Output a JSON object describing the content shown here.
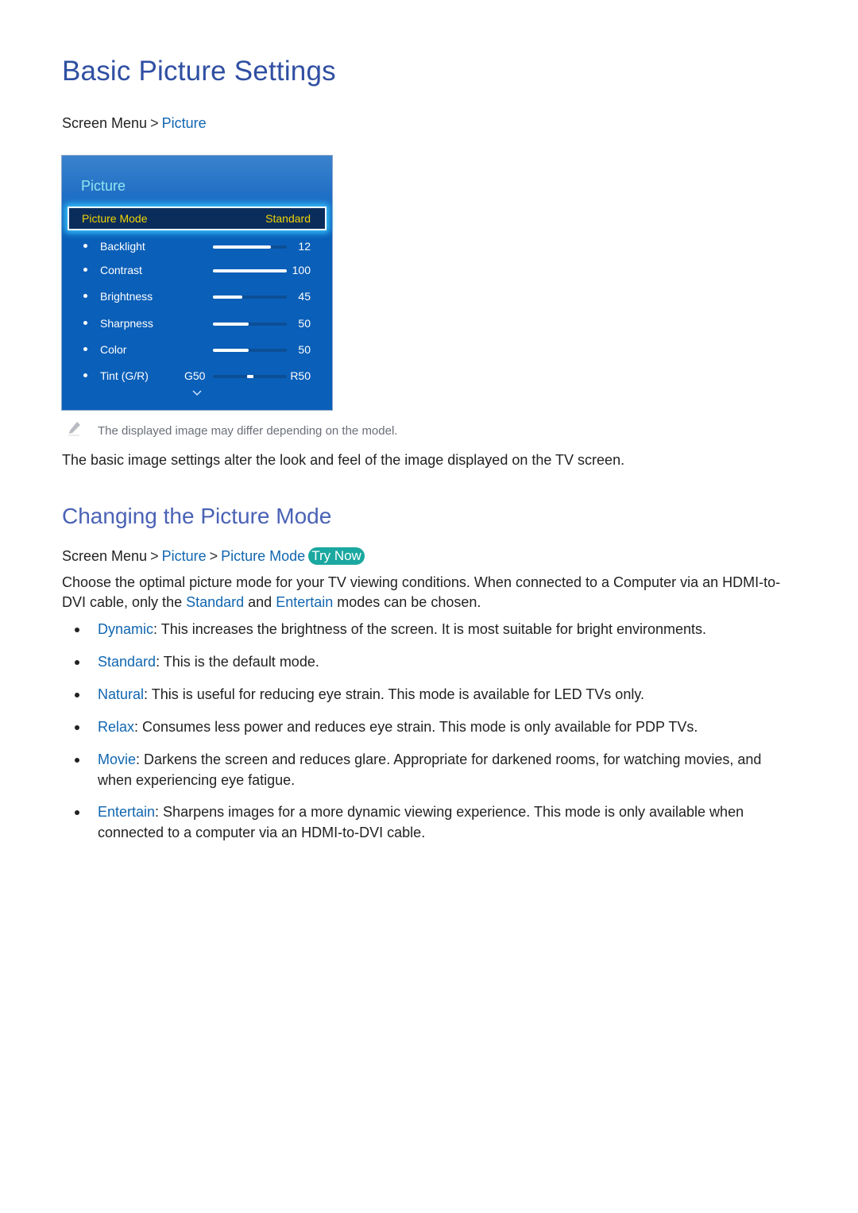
{
  "title": "Basic Picture Settings",
  "breadcrumb1": {
    "root": "Screen Menu",
    "items": [
      "Picture"
    ]
  },
  "tv_menu": {
    "title": "Picture",
    "picture_mode": {
      "label": "Picture Mode",
      "value": "Standard"
    },
    "settings": [
      {
        "label": "Backlight",
        "value": "12",
        "fill_fraction": 0.79
      },
      {
        "label": "Contrast",
        "value": "100",
        "fill_fraction": 1.0
      },
      {
        "label": "Brightness",
        "value": "45",
        "fill_fraction": 0.4
      },
      {
        "label": "Sharpness",
        "value": "50",
        "fill_fraction": 0.48
      },
      {
        "label": "Color",
        "value": "50",
        "fill_fraction": 0.48
      }
    ],
    "tint": {
      "label": "Tint (G/R)",
      "left": "G50",
      "right": "R50",
      "position_fraction": 0.5
    },
    "more_icon": "chevron-down-icon",
    "colors": {
      "selection_text": "#f0d400",
      "title_text": "#8fe6f0",
      "panel_bg": "#0a5fb8"
    }
  },
  "note": {
    "icon": "pencil-icon",
    "text": "The displayed image may differ depending on the model."
  },
  "intro": "The basic image settings alter the look and feel of the image displayed on the TV screen.",
  "section": {
    "title": "Changing the Picture Mode",
    "breadcrumb": {
      "root": "Screen Menu",
      "items": [
        "Picture",
        "Picture Mode"
      ],
      "try_now": "Try Now"
    },
    "para": {
      "part1": "Choose the optimal picture mode for your TV viewing conditions. When connected to a Computer via an HDMI-to-DVI cable, only the ",
      "kw1": "Standard",
      "part2": " and ",
      "kw2": "Entertain",
      "part3": " modes can be chosen."
    },
    "modes": [
      {
        "name": "Dynamic",
        "desc": ": This increases the brightness of the screen. It is most suitable for bright environments."
      },
      {
        "name": "Standard",
        "desc": ": This is the default mode."
      },
      {
        "name": "Natural",
        "desc": ": This is useful for reducing eye strain. This mode is available for LED TVs only."
      },
      {
        "name": "Relax",
        "desc": ": Consumes less power and reduces eye strain. This mode is only available for PDP TVs."
      },
      {
        "name": "Movie",
        "desc": ": Darkens the screen and reduces glare. Appropriate for darkened rooms, for watching movies, and when experiencing eye fatigue."
      },
      {
        "name": "Entertain",
        "desc": ": Sharpens images for a more dynamic viewing experience. This mode is only available when connected to a computer via an HDMI-to-DVI cable."
      }
    ]
  },
  "colors": {
    "heading": "#2f4fa2",
    "link": "#1166b0",
    "try_now_bg": "#1aa8a0"
  }
}
